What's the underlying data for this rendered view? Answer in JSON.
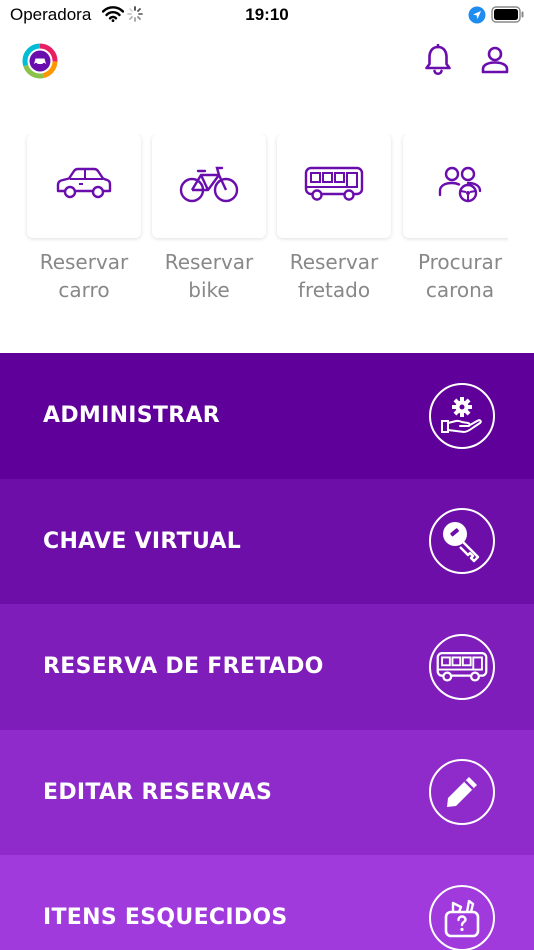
{
  "status_bar": {
    "carrier": "Operadora",
    "time": "19:10"
  },
  "header": {
    "logo_icon": "app-logo-icon",
    "notification_icon": "bell-icon",
    "profile_icon": "user-icon"
  },
  "quick_actions": [
    {
      "label_line1": "Reservar",
      "label_line2": "carro",
      "icon": "car-icon"
    },
    {
      "label_line1": "Reservar",
      "label_line2": "bike",
      "icon": "bike-icon"
    },
    {
      "label_line1": "Reservar",
      "label_line2": "fretado",
      "icon": "bus-icon"
    },
    {
      "label_line1": "Procurar",
      "label_line2": "carona",
      "icon": "carpool-icon"
    }
  ],
  "menu": [
    {
      "label": "ADMINISTRAR",
      "icon": "admin-icon",
      "color": "#5e0099"
    },
    {
      "label": "CHAVE VIRTUAL",
      "icon": "key-icon",
      "color": "#6d0ea9"
    },
    {
      "label": "RESERVA DE FRETADO",
      "icon": "bus-icon",
      "color": "#7f1dbb"
    },
    {
      "label": "EDITAR RESERVAS",
      "icon": "pencil-icon",
      "color": "#8f2bcb"
    },
    {
      "label": "ITENS ESQUECIDOS",
      "icon": "lost-items-icon",
      "color": "#a03add"
    }
  ],
  "colors": {
    "accent": "#6a0dad",
    "label_gray": "#888888"
  }
}
